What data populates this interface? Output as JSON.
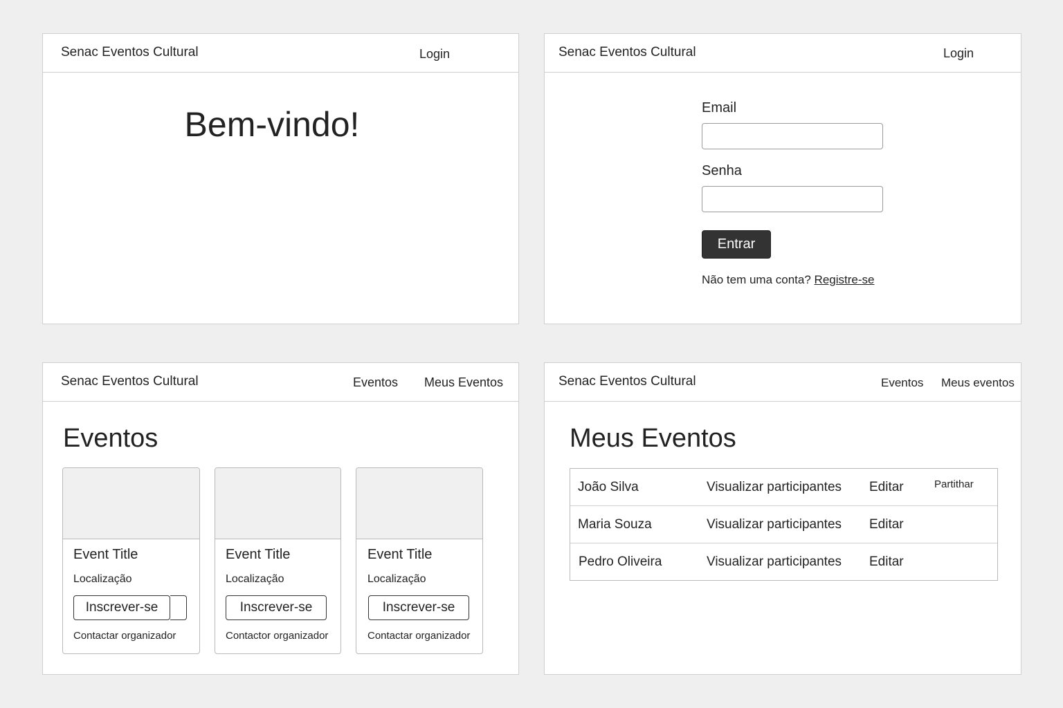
{
  "brand": "Senac Eventos Cultural",
  "home": {
    "nav_login": "Login",
    "welcome": "Bem-vindo!"
  },
  "login": {
    "nav_login": "Login",
    "email_label": "Email",
    "email_value": "",
    "password_label": "Senha",
    "password_value": "",
    "submit_label": "Entrar",
    "signup_prompt": "Não tem uma conta?",
    "signup_link": "Registre-se"
  },
  "events": {
    "nav": [
      "Eventos",
      "Meus Eventos"
    ],
    "title": "Eventos",
    "cards": [
      {
        "title": "Event Title",
        "location": "Localização",
        "button": "Inscrever-se",
        "contact": "Contactar organizador"
      },
      {
        "title": "Event Title",
        "location": "Localização",
        "button": "Inscrever-se",
        "contact": "Contactor organizador"
      },
      {
        "title": "Event Title",
        "location": "Localização",
        "button": "Inscrever-se",
        "contact": "Contactar organizador"
      }
    ]
  },
  "my_events": {
    "nav": [
      "Eventos",
      "Meus eventos"
    ],
    "title": "Meus Eventos",
    "rows": [
      {
        "name": "João Silva",
        "view": "Visualizar participantes",
        "edit": "Editar",
        "share": "Partithar"
      },
      {
        "name": "Maria Souza",
        "view": "Visualizar participantes",
        "edit": "Editar",
        "share": ""
      },
      {
        "name": "Pedro Oliveira",
        "view": "Visualizar participantes",
        "edit": "Editar",
        "share": ""
      }
    ]
  }
}
